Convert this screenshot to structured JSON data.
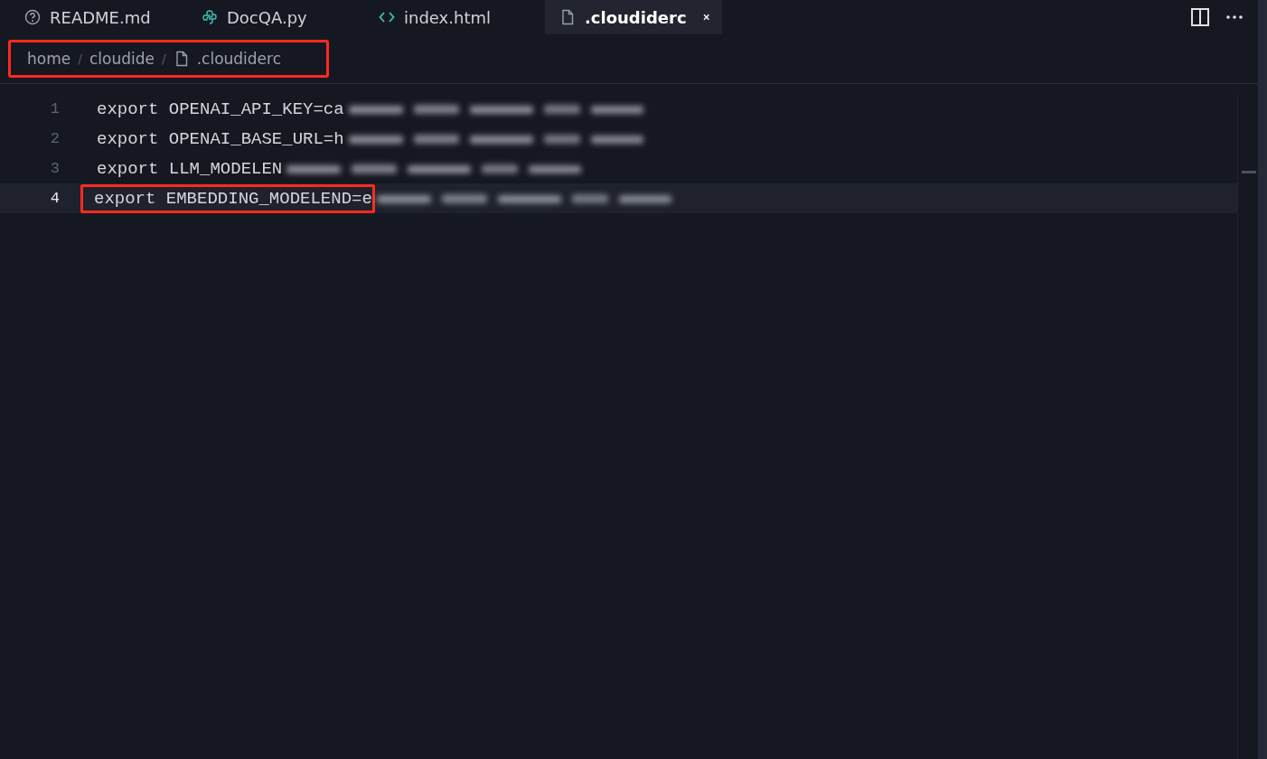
{
  "tabs": [
    {
      "label": "README.md",
      "kind": "help",
      "selected": false
    },
    {
      "label": "DocQA.py",
      "kind": "python",
      "selected": false
    },
    {
      "label": "index.html",
      "kind": "code",
      "selected": false
    },
    {
      "label": ".cloudiderc",
      "kind": "file",
      "selected": true
    }
  ],
  "breadcrumb": {
    "highlighted": true,
    "items": [
      {
        "label": "home",
        "kind": "folder"
      },
      {
        "separator": "/",
        "label": "cloudide",
        "kind": "folder"
      },
      {
        "separator": "/",
        "label": ".cloudiderc",
        "kind": "file"
      }
    ]
  },
  "editor": {
    "lines": [
      {
        "number": "1",
        "text": "export OPENAI_API_KEY=ca",
        "redacted": true,
        "current": false,
        "highlighted": false
      },
      {
        "number": "2",
        "text": "export OPENAI_BASE_URL=h",
        "redacted": true,
        "current": false,
        "highlighted": false
      },
      {
        "number": "3",
        "text": "export LLM_MODELEN",
        "redacted": true,
        "current": false,
        "highlighted": false
      },
      {
        "number": "4",
        "text": "export EMBEDDING_MODELEND=e",
        "redacted": true,
        "current": true,
        "highlighted": true
      }
    ]
  }
}
